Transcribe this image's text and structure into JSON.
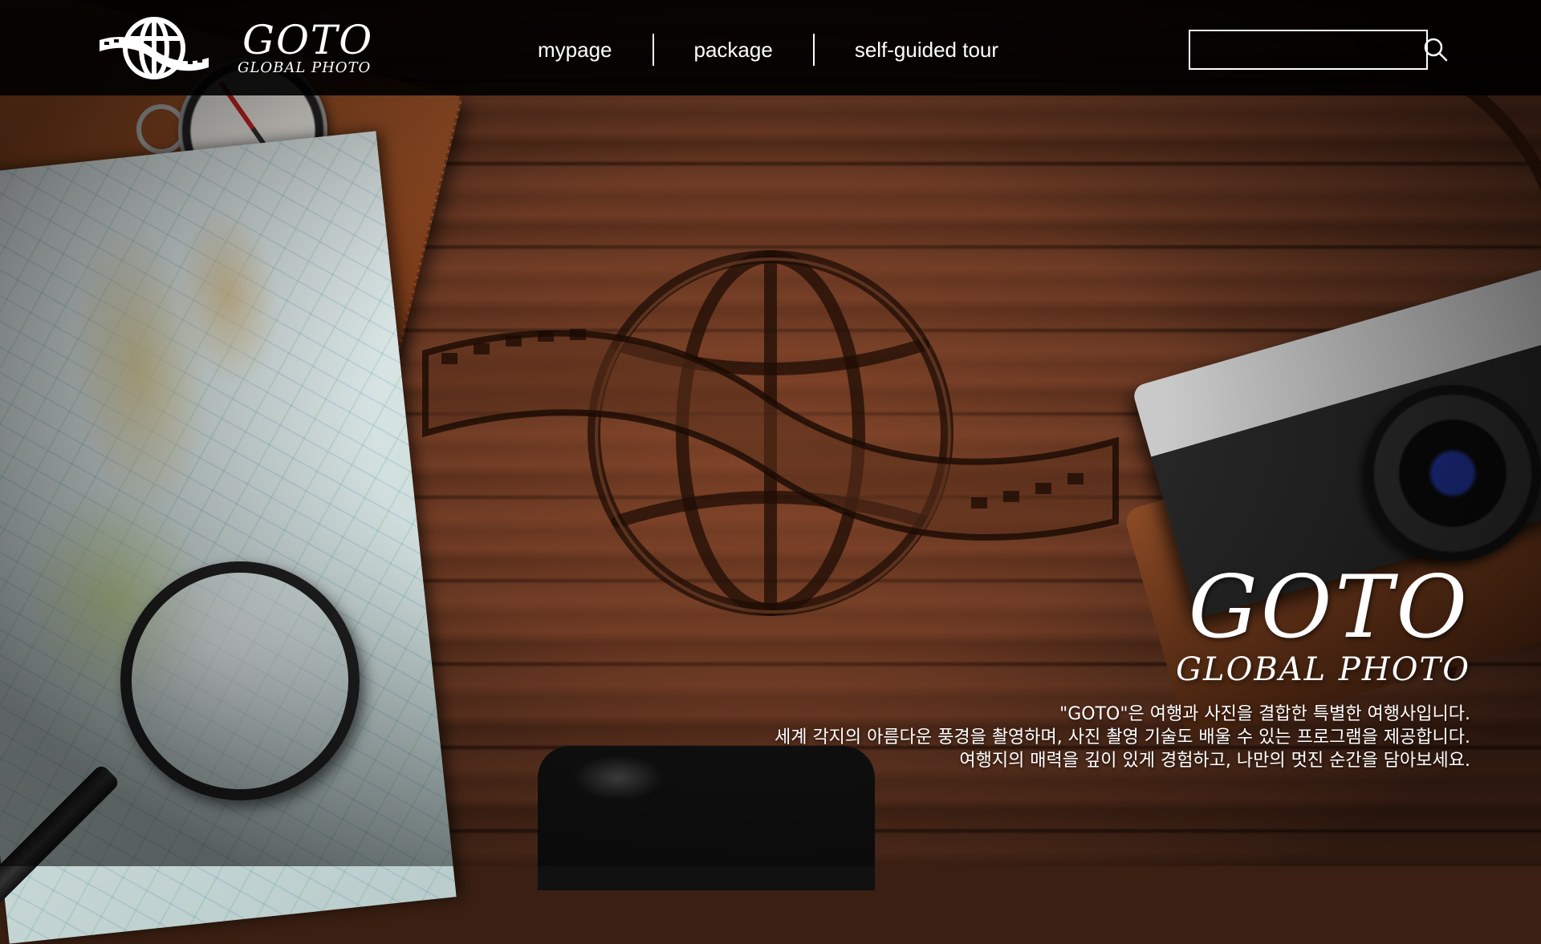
{
  "brand": {
    "title": "GOTO",
    "subtitle": "GLOBAL PHOTO",
    "icon": "globe-film-icon"
  },
  "nav": {
    "items": [
      {
        "label": "mypage"
      },
      {
        "label": "package"
      },
      {
        "label": "self-guided tour"
      }
    ]
  },
  "search": {
    "value": "",
    "placeholder": "",
    "icon": "search-icon"
  },
  "hero": {
    "title": "GOTO",
    "subtitle": "GLOBAL PHOTO",
    "description": [
      "\"GOTO\"은 여행과 사진을 결합한 특별한 여행사입니다.",
      "세계 각지의 아름다운 풍경을 촬영하며, 사진 촬영 기술도 배울 수 있는 프로그램을 제공합니다.",
      "여행지의 매력을 깊이 있게 경험하고, 나만의 멋진 순간을 담아보세요."
    ]
  },
  "colors": {
    "topbar": "#000000",
    "text": "#ffffff",
    "wood": "#5e3320"
  }
}
